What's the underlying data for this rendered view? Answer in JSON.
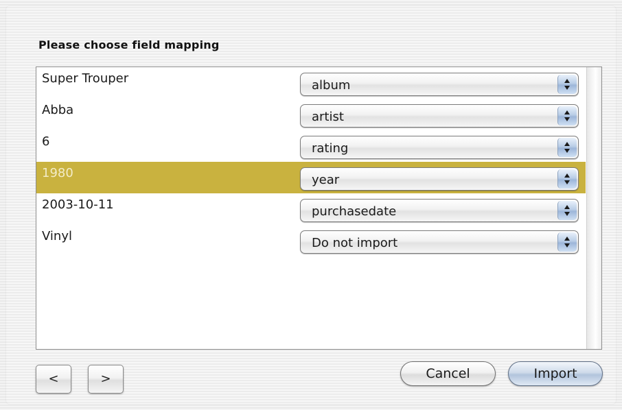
{
  "dialog": {
    "heading": "Please choose field mapping"
  },
  "mapping": {
    "rows": [
      {
        "label": "Super Trouper",
        "value": "album",
        "selected": false
      },
      {
        "label": "Abba",
        "value": "artist",
        "selected": false
      },
      {
        "label": "6",
        "value": "rating",
        "selected": false
      },
      {
        "label": "1980",
        "value": "year",
        "selected": true
      },
      {
        "label": "2003-10-11",
        "value": "purchasedate",
        "selected": false
      },
      {
        "label": "Vinyl",
        "value": "Do not import",
        "selected": false
      }
    ]
  },
  "buttons": {
    "prev": "<",
    "next": ">",
    "cancel": "Cancel",
    "import": "Import"
  },
  "colors": {
    "selection": "#c9b23f",
    "selection_text": "#f3ecc8",
    "aqua_arrows": "#9db6d9"
  }
}
